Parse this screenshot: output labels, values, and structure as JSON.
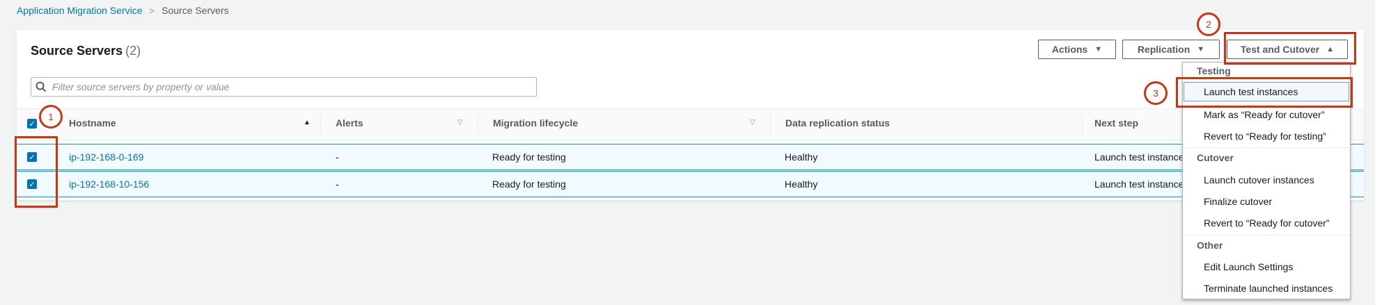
{
  "breadcrumb": {
    "parent": "Application Migration Service",
    "separator": ">",
    "current": "Source Servers"
  },
  "panel": {
    "title": "Source Servers",
    "count": "(2)"
  },
  "buttons": {
    "actions": "Actions",
    "replication": "Replication",
    "test_cutover": "Test and Cutover"
  },
  "search": {
    "placeholder": "Filter source servers by property or value"
  },
  "table": {
    "columns": {
      "hostname": "Hostname",
      "alerts": "Alerts",
      "lifecycle": "Migration lifecycle",
      "replication": "Data replication status",
      "next_step": "Next step"
    },
    "rows": [
      {
        "hostname": "ip-192-168-0-169",
        "alerts": "-",
        "lifecycle": "Ready for testing",
        "replication": "Healthy",
        "next_step": "Launch test instances",
        "checked": true
      },
      {
        "hostname": "ip-192-168-10-156",
        "alerts": "-",
        "lifecycle": "Ready for testing",
        "replication": "Healthy",
        "next_step": "Launch test instances",
        "checked": true
      }
    ]
  },
  "menu": {
    "groups": {
      "testing": "Testing",
      "cutover": "Cutover",
      "other": "Other"
    },
    "items": {
      "launch_test": "Launch test instances",
      "mark_ready_cutover": "Mark as “Ready for cutover”",
      "revert_testing": "Revert to “Ready for testing”",
      "launch_cutover": "Launch cutover instances",
      "finalize_cutover": "Finalize cutover",
      "revert_cutover": "Revert to “Ready for cutover”",
      "edit_launch": "Edit Launch Settings",
      "terminate": "Terminate launched instances"
    }
  },
  "annotations": {
    "step1": "1",
    "step2": "2",
    "step3": "3"
  },
  "colors": {
    "link": "#0073bb",
    "annotation": "#d13212",
    "selected_row": "#f1faff"
  }
}
